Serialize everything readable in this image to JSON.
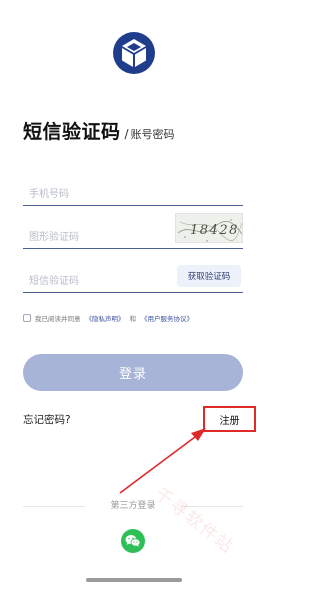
{
  "header": {
    "title": "短信验证码",
    "separator": "/",
    "alt_mode": "账号密码"
  },
  "form": {
    "phone_placeholder": "手机号码",
    "graphic_code_placeholder": "图形验证码",
    "captcha_text": "18428",
    "sms_code_placeholder": "短信验证码",
    "get_code_label": "获取验证码"
  },
  "agreement": {
    "checked": false,
    "text": "我已阅读并同意",
    "privacy_link": "《隐私声明》",
    "and_text": "和",
    "terms_link": "《用户服务协议》"
  },
  "login_label": "登录",
  "forgot_label": "忘记密码?",
  "register_label": "注册",
  "third_party": {
    "label": "第三方登录",
    "providers": [
      "wechat"
    ]
  },
  "watermark": "千寻软件站",
  "colors": {
    "brand": "#1f3a8a",
    "login_button": "#a7b3d7",
    "highlight": "#e02a2a",
    "wechat": "#2fbf57"
  }
}
